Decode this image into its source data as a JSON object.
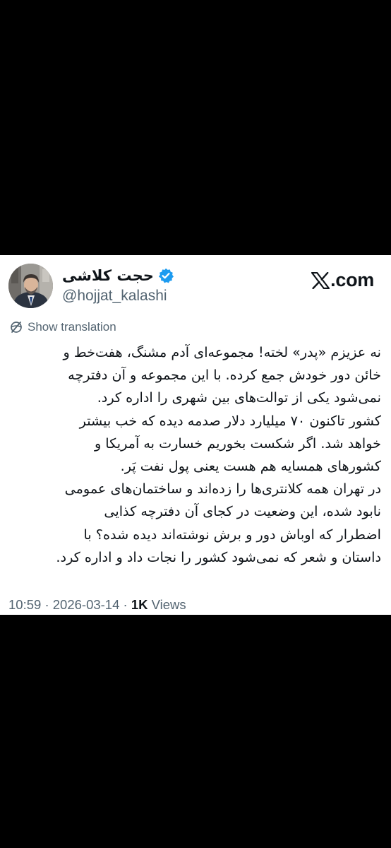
{
  "tweet": {
    "author_name": "حجت کلاشی",
    "author_handle": "@hojjat_kalashi",
    "verified": true,
    "site_domain": ".com",
    "translate_label": "Show translation",
    "body_lines": [
      "نه عزیزم «پدر» لخته! مجموعه‌ای آدم مشنگ، هفت‌خط و",
      "خائن دور خودش جمع کرده. با این مجموعه و آن دفترچه",
      "نمی‌شود یکی از توالت‌های بین شهری را اداره کرد.",
      "کشور تاکنون ۷۰ میلیارد دلار صدمه دیده که خب بیشتر",
      "خواهد شد. اگر شکست بخوریم خسارت به آمریکا و",
      "کشورهای همسایه هم هست یعنی پول نفت پَر.",
      "در تهران همه کلانتری‌ها را زده‌اند و ساختمان‌های عمومی",
      "نابود شده، این وضعیت در کجای آن دفترچه کذایی",
      "اضطرار که اوباش دور و برش نوشته‌اند دیده شده؟ با",
      "داستان و شعر که نمی‌شود کشور را نجات داد و اداره کرد."
    ],
    "time": "10:59",
    "separator": "·",
    "date": "2026-03-14",
    "views_count": "1K",
    "views_label": "Views",
    "colors": {
      "verified_blue": "#1d9bf0",
      "secondary_text": "#536471",
      "primary_text": "#0f1419"
    },
    "icons": {
      "verified": "verified-badge-icon",
      "logo": "x-logo-icon",
      "translate": "globe-icon"
    }
  }
}
